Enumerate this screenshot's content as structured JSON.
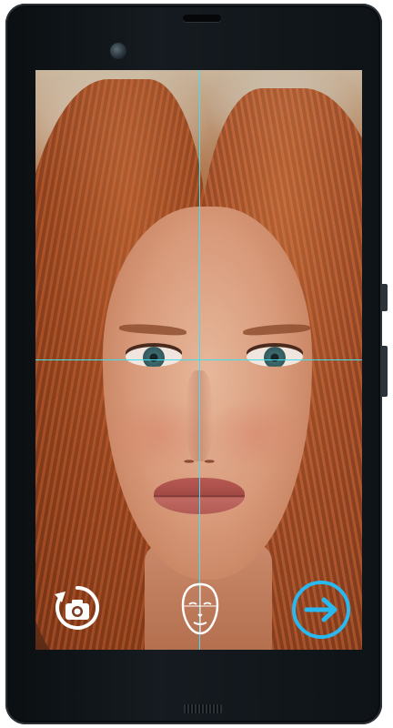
{
  "device": {
    "type": "smartphone",
    "color": "#0f1418"
  },
  "camera_view": {
    "guide_color": "#3fe0f0",
    "guides": [
      "vertical-center-line",
      "horizontal-eye-line"
    ]
  },
  "controls": {
    "switch_camera": {
      "icon": "camera-rotate-icon",
      "color": "#ffffff"
    },
    "face_guide": {
      "icon": "face-outline-icon",
      "color": "#ffffff"
    },
    "next": {
      "icon": "arrow-right-icon",
      "color": "#29b8f0"
    }
  }
}
